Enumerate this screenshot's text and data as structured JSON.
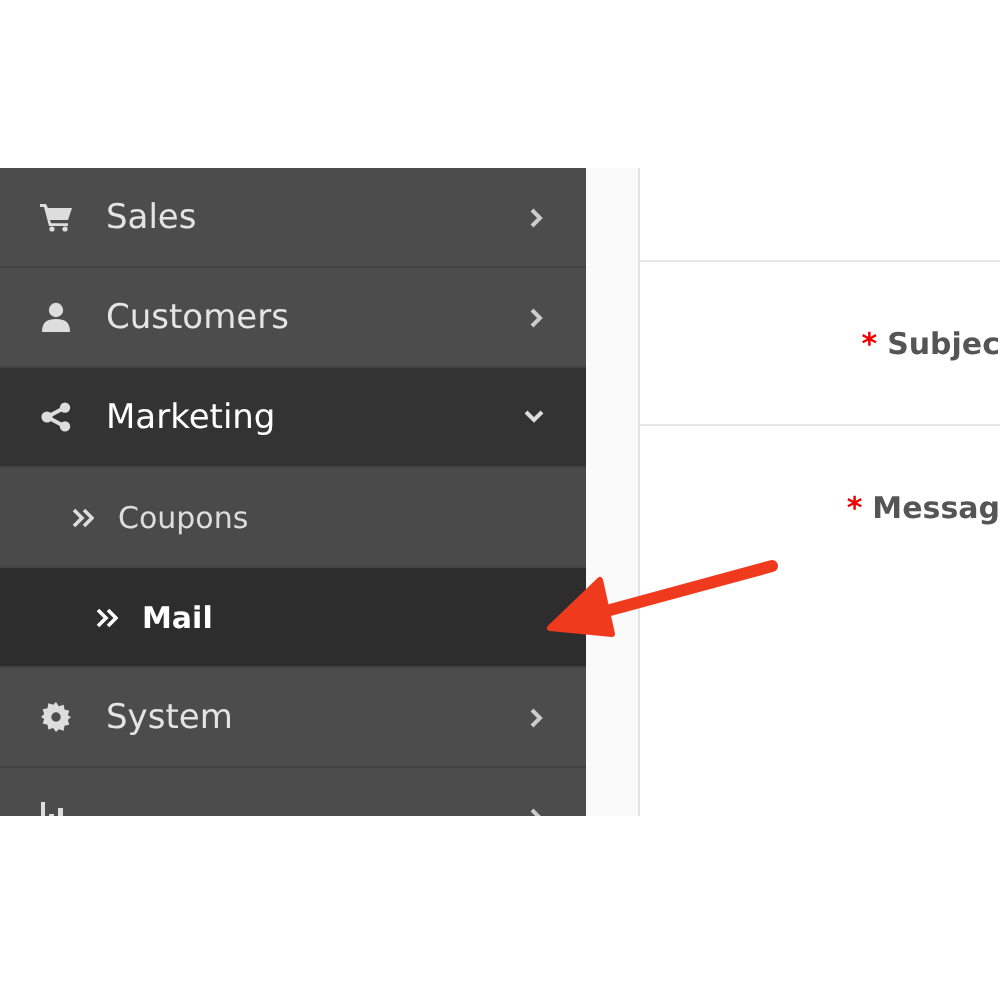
{
  "sidebar": {
    "items": [
      {
        "label": "Sales",
        "expanded": false
      },
      {
        "label": "Customers",
        "expanded": false
      },
      {
        "label": "Marketing",
        "expanded": true,
        "children": [
          {
            "label": "Coupons",
            "selected": false
          },
          {
            "label": "Mail",
            "selected": true
          }
        ]
      },
      {
        "label": "System",
        "expanded": false
      },
      {
        "expanded": false
      }
    ]
  },
  "form": {
    "fields": [
      {
        "required_mark": "*",
        "label": "Subjec"
      },
      {
        "required_mark": "*",
        "label": "Messag"
      }
    ]
  }
}
